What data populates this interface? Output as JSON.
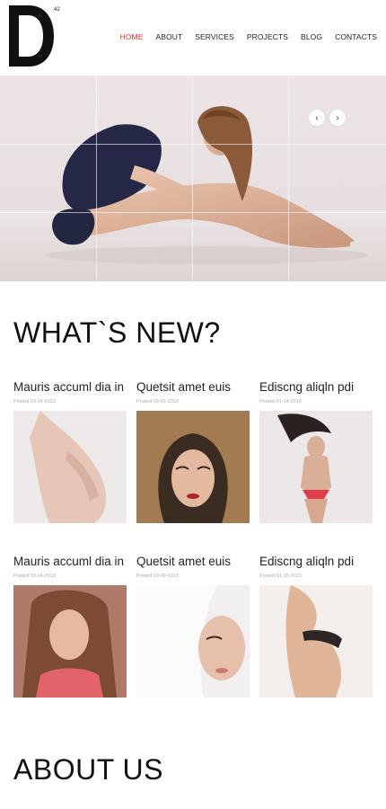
{
  "header": {
    "logo_letter": "D",
    "logo_sup": "42",
    "nav": [
      "HOME",
      "ABOUT",
      "SERVICES",
      "PROJECTS",
      "BLOG",
      "CONTACTS"
    ],
    "nav_active": "HOME",
    "accent": "#e0312f"
  },
  "slider": {
    "prev_icon": "‹",
    "next_icon": "›"
  },
  "whats_new": {
    "heading": "WHAT`S NEW?",
    "posts": [
      {
        "title": "Mauris accuml dia in",
        "posted": "Posted  03-14-2013"
      },
      {
        "title": "Quetsit amet euis",
        "posted": "Posted  03-01-2013"
      },
      {
        "title": "Ediscng aliqln pdi",
        "posted": "Posted  01-14-2013"
      },
      {
        "title": "Mauris accuml dia in",
        "posted": "Posted  03-14-2013"
      },
      {
        "title": "Quetsit amet euis",
        "posted": "Posted  03-09-2013"
      },
      {
        "title": "Ediscng aliqln pdi",
        "posted": "Posted  01-15-2013"
      }
    ]
  },
  "about": {
    "heading": "ABOUT US"
  }
}
